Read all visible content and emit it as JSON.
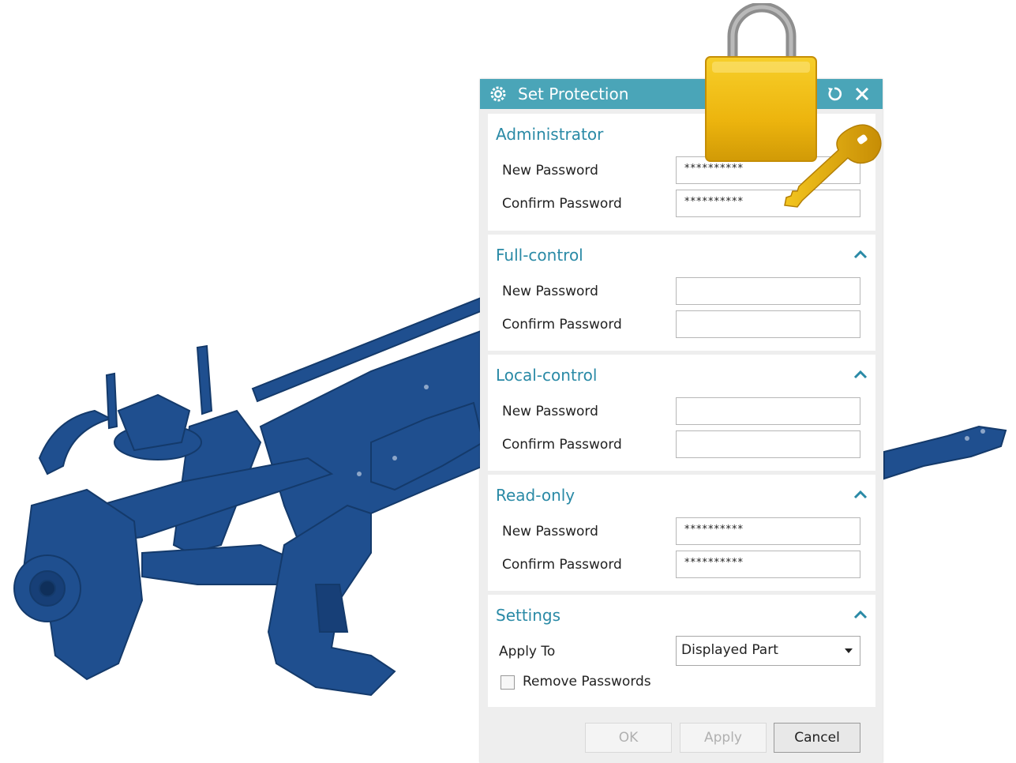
{
  "dialog": {
    "title": "Set Protection",
    "accent_color": "#4aa5b8",
    "title_icon": "gear-icon",
    "reset_icon": "reset-icon",
    "close_icon": "close-icon"
  },
  "groups": {
    "administrator": {
      "title": "Administrator",
      "new_password_label": "New Password",
      "confirm_password_label": "Confirm Password",
      "new_password_value": "**********",
      "confirm_password_value": "**********"
    },
    "full_control": {
      "title": "Full-control",
      "new_password_label": "New Password",
      "confirm_password_label": "Confirm Password",
      "new_password_value": "",
      "confirm_password_value": ""
    },
    "local_control": {
      "title": "Local-control",
      "new_password_label": "New Password",
      "confirm_password_label": "Confirm Password",
      "new_password_value": "",
      "confirm_password_value": ""
    },
    "read_only": {
      "title": "Read-only",
      "new_password_label": "New Password",
      "confirm_password_label": "Confirm Password",
      "new_password_value": "**********",
      "confirm_password_value": "**********"
    },
    "settings": {
      "title": "Settings",
      "apply_to_label": "Apply To",
      "apply_to_value": "Displayed Part",
      "remove_passwords_label": "Remove Passwords",
      "remove_passwords_checked": false
    }
  },
  "buttons": {
    "ok": "OK",
    "apply": "Apply",
    "cancel": "Cancel"
  },
  "decor": {
    "lock_icon": "padlock-icon",
    "key_icon": "key-icon",
    "background_image": "suspension-assembly-model"
  }
}
